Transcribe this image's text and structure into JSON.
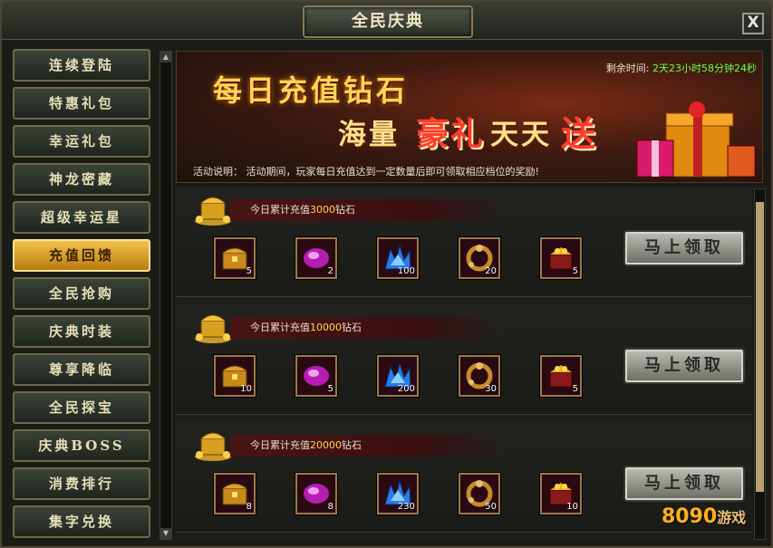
{
  "window": {
    "title": "全民庆典",
    "close_label": "X"
  },
  "sidebar": {
    "items": [
      {
        "label": "连续登陆",
        "active": false
      },
      {
        "label": "特惠礼包",
        "active": false
      },
      {
        "label": "幸运礼包",
        "active": false
      },
      {
        "label": "神龙密藏",
        "active": false
      },
      {
        "label": "超级幸运星",
        "active": false
      },
      {
        "label": "充值回馈",
        "active": true
      },
      {
        "label": "全民抢购",
        "active": false
      },
      {
        "label": "庆典时装",
        "active": false
      },
      {
        "label": "尊享降临",
        "active": false
      },
      {
        "label": "全民探宝",
        "active": false
      },
      {
        "label": "庆典BOSS",
        "active": false
      },
      {
        "label": "消费排行",
        "active": false
      },
      {
        "label": "集字兑换",
        "active": false
      }
    ]
  },
  "banner": {
    "headline": "每日充值钻石",
    "sub_a": "海量",
    "sub_b": "豪礼",
    "sub_c": "天天",
    "sub_d": "送",
    "countdown_label": "剩余时间:",
    "countdown_value": "2天23小时58分钟24秒",
    "desc": "活动说明：  活动期间，玩家每日充值达到一定数量后即可领取相应档位的奖励!"
  },
  "tiers": [
    {
      "prefix": "今日累计充值",
      "amount": "3000",
      "suffix": "钻石",
      "items": [
        "5",
        "2",
        "100",
        "20",
        "5"
      ],
      "button": "马上领取"
    },
    {
      "prefix": "今日累计充值",
      "amount": "10000",
      "suffix": "钻石",
      "items": [
        "10",
        "5",
        "200",
        "30",
        "5"
      ],
      "button": "马上领取"
    },
    {
      "prefix": "今日累计充值",
      "amount": "20000",
      "suffix": "钻石",
      "items": [
        "8",
        "8",
        "230",
        "50",
        "10"
      ],
      "button": "马上领取"
    }
  ],
  "watermark": {
    "brand": "8090",
    "suffix": "游戏"
  },
  "colors": {
    "accent_gold": "#f0c24a",
    "countdown_green": "#6aff4a",
    "amount_yellow": "#ffd84a"
  },
  "icons": [
    "treasure-chest-icon",
    "purple-gem-icon",
    "blue-crystal-icon",
    "gold-ring-icon",
    "gold-box-icon"
  ]
}
